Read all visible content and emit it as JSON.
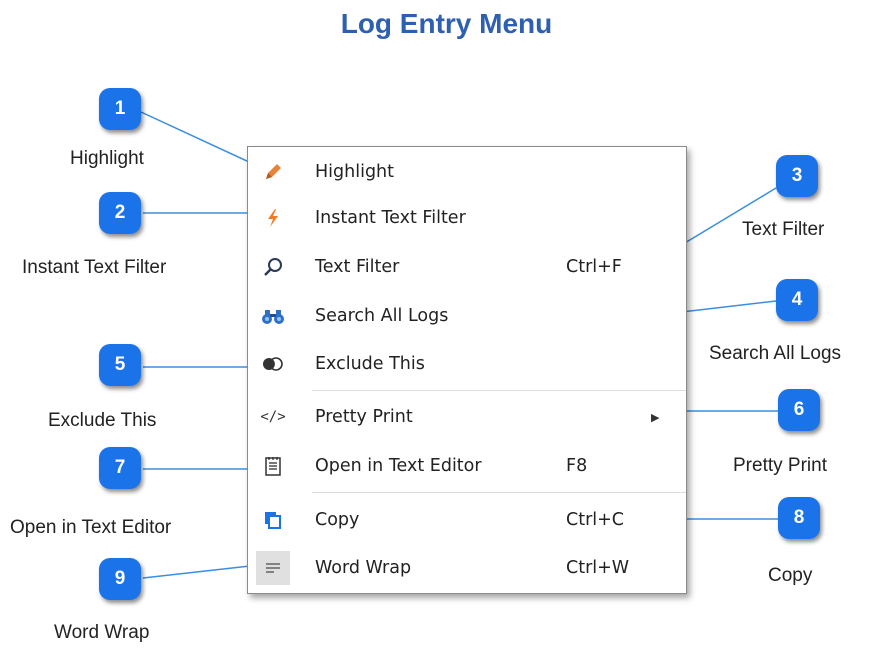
{
  "page": {
    "title": "Log Entry Menu"
  },
  "menu": {
    "items": [
      {
        "label": "Highlight",
        "shortcut": "",
        "icon": "pencil-icon",
        "color": "#e8833a"
      },
      {
        "label": "Instant Text Filter",
        "shortcut": "",
        "icon": "lightning-icon",
        "color": "#f47b20"
      },
      {
        "label": "Text Filter",
        "shortcut": "Ctrl+F",
        "icon": "magnifier-icon",
        "color": "#2b3a55"
      },
      {
        "label": "Search All Logs",
        "shortcut": "",
        "icon": "binoculars-icon",
        "color": "#2e6fc7"
      },
      {
        "label": "Exclude This",
        "shortcut": "",
        "icon": "exclude-toggle-icon",
        "color": "#333333"
      },
      {
        "label": "Pretty Print",
        "shortcut": "",
        "icon": "code-icon",
        "color": "#333333",
        "submenu": true
      },
      {
        "label": "Open in Text Editor",
        "shortcut": "F8",
        "icon": "notepad-icon",
        "color": "#333333"
      },
      {
        "label": "Copy",
        "shortcut": "Ctrl+C",
        "icon": "copy-icon",
        "color": "#1a73e8"
      },
      {
        "label": "Word Wrap",
        "shortcut": "Ctrl+W",
        "icon": "word-wrap-icon",
        "color": "#777777"
      }
    ]
  },
  "callouts": [
    {
      "number": "1",
      "label": "Highlight"
    },
    {
      "number": "2",
      "label": "Instant Text Filter"
    },
    {
      "number": "3",
      "label": "Text Filter"
    },
    {
      "number": "4",
      "label": "Search All Logs"
    },
    {
      "number": "5",
      "label": "Exclude This"
    },
    {
      "number": "6",
      "label": "Pretty Print"
    },
    {
      "number": "7",
      "label": "Open in Text Editor"
    },
    {
      "number": "8",
      "label": "Copy"
    },
    {
      "number": "9",
      "label": "Word Wrap"
    }
  ],
  "colors": {
    "badge": "#1a73e8",
    "title": "#2e5fb0",
    "connector": "#3b8ee0"
  }
}
